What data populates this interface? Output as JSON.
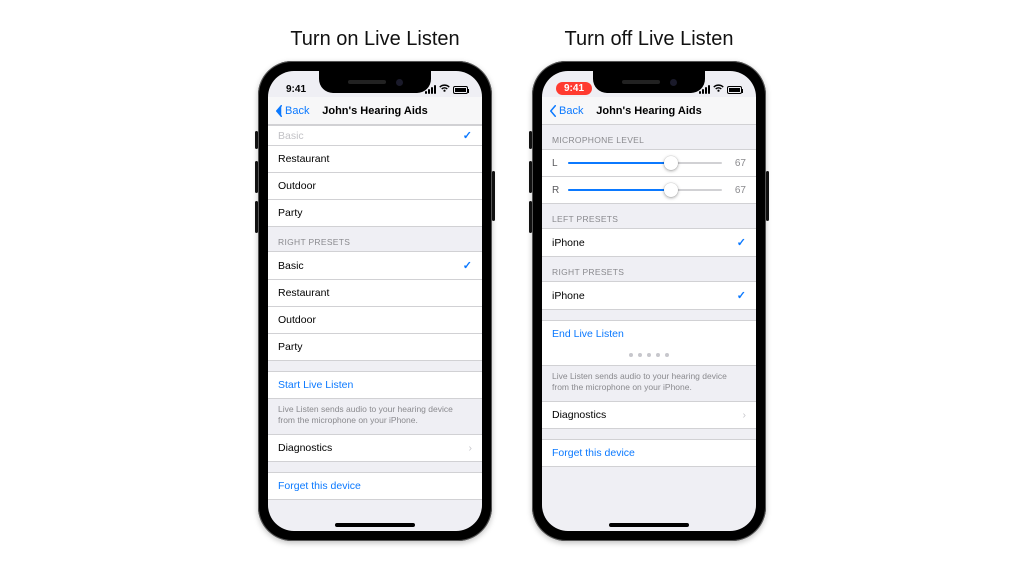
{
  "captions": {
    "on": "Turn on Live Listen",
    "off": "Turn off Live Listen"
  },
  "status": {
    "time": "9:41"
  },
  "nav": {
    "back": "Back",
    "title": "John's Hearing Aids"
  },
  "screenA": {
    "top_dim_item": "Basic",
    "left_presets_rest": [
      "Restaurant",
      "Outdoor",
      "Party"
    ],
    "right_header": "RIGHT PRESETS",
    "right_presets": [
      {
        "label": "Basic",
        "selected": true
      },
      {
        "label": "Restaurant",
        "selected": false
      },
      {
        "label": "Outdoor",
        "selected": false
      },
      {
        "label": "Party",
        "selected": false
      }
    ],
    "start": "Start Live Listen",
    "note": "Live Listen sends audio to your hearing device from the microphone on your iPhone.",
    "diagnostics": "Diagnostics",
    "forget": "Forget this device"
  },
  "screenB": {
    "mic_header": "MICROPHONE LEVEL",
    "sliders": [
      {
        "label": "L",
        "value": 67,
        "max": 100
      },
      {
        "label": "R",
        "value": 67,
        "max": 100
      }
    ],
    "left_header": "LEFT PRESETS",
    "left_preset": "iPhone",
    "right_header": "RIGHT PRESETS",
    "right_preset": "iPhone",
    "end": "End Live Listen",
    "note": "Live Listen sends audio to your hearing device from the microphone on your iPhone.",
    "diagnostics": "Diagnostics",
    "forget": "Forget this device"
  }
}
